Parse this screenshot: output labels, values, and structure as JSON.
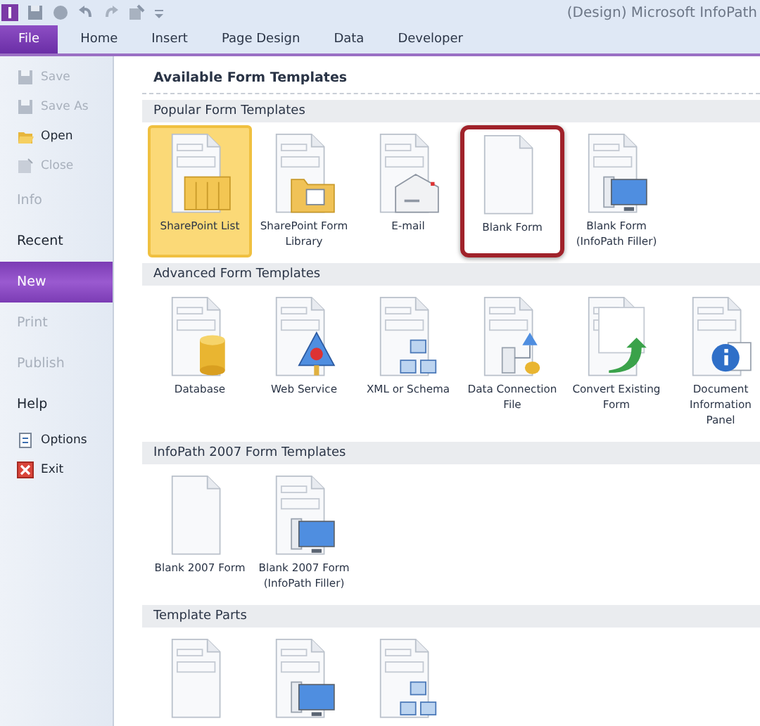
{
  "window": {
    "title": "(Design) Microsoft InfoPath"
  },
  "ribbon_tabs": [
    {
      "label": "File",
      "selected": true
    },
    {
      "label": "Home",
      "selected": false
    },
    {
      "label": "Insert",
      "selected": false
    },
    {
      "label": "Page Design",
      "selected": false
    },
    {
      "label": "Data",
      "selected": false
    },
    {
      "label": "Developer",
      "selected": false
    }
  ],
  "sidebar": {
    "items": [
      {
        "label": "Save",
        "kind": "save",
        "disabled": true
      },
      {
        "label": "Save As",
        "kind": "saveas",
        "disabled": true
      },
      {
        "label": "Open",
        "kind": "open",
        "disabled": false
      },
      {
        "label": "Close",
        "kind": "close",
        "disabled": true
      },
      {
        "label": "Info",
        "kind": "section",
        "disabled": true,
        "selected": false
      },
      {
        "label": "Recent",
        "kind": "section",
        "disabled": false,
        "selected": false
      },
      {
        "label": "New",
        "kind": "section",
        "disabled": false,
        "selected": true
      },
      {
        "label": "Print",
        "kind": "section",
        "disabled": true,
        "selected": false
      },
      {
        "label": "Publish",
        "kind": "section",
        "disabled": true,
        "selected": false
      },
      {
        "label": "Help",
        "kind": "section",
        "disabled": false,
        "selected": false
      },
      {
        "label": "Options",
        "kind": "options",
        "disabled": false
      },
      {
        "label": "Exit",
        "kind": "exit",
        "disabled": false
      }
    ]
  },
  "heading": "Available Form Templates",
  "groups": [
    {
      "title": "Popular Form Templates",
      "templates": [
        {
          "label": "SharePoint List",
          "kind": "list",
          "selected": true,
          "outlined": false
        },
        {
          "label": "SharePoint Form Library",
          "kind": "folder",
          "selected": false,
          "outlined": false
        },
        {
          "label": "E-mail",
          "kind": "email",
          "selected": false,
          "outlined": false
        },
        {
          "label": "Blank Form",
          "kind": "blank",
          "selected": false,
          "outlined": true
        },
        {
          "label": "Blank Form (InfoPath Filler)",
          "kind": "filler",
          "selected": false,
          "outlined": false
        }
      ]
    },
    {
      "title": "Advanced Form Templates",
      "templates": [
        {
          "label": "Database",
          "kind": "database",
          "selected": false,
          "outlined": false
        },
        {
          "label": "Web Service",
          "kind": "webservice",
          "selected": false,
          "outlined": false
        },
        {
          "label": "XML or Schema",
          "kind": "xml",
          "selected": false,
          "outlined": false
        },
        {
          "label": "Data Connection File",
          "kind": "connection",
          "selected": false,
          "outlined": false
        },
        {
          "label": "Convert Existing Form",
          "kind": "convert",
          "selected": false,
          "outlined": false
        },
        {
          "label": "Document Information Panel",
          "kind": "info",
          "selected": false,
          "outlined": false
        }
      ]
    },
    {
      "title": "InfoPath 2007 Form Templates",
      "templates": [
        {
          "label": "Blank 2007 Form",
          "kind": "blank",
          "selected": false,
          "outlined": false
        },
        {
          "label": "Blank 2007 Form (InfoPath Filler)",
          "kind": "filler",
          "selected": false,
          "outlined": false
        }
      ]
    },
    {
      "title": "Template Parts",
      "templates": [
        {
          "kind": "partblank",
          "selected": false,
          "outlined": false
        },
        {
          "kind": "partfiller",
          "selected": false,
          "outlined": false
        },
        {
          "kind": "partxml",
          "selected": false,
          "outlined": false
        }
      ]
    }
  ]
}
